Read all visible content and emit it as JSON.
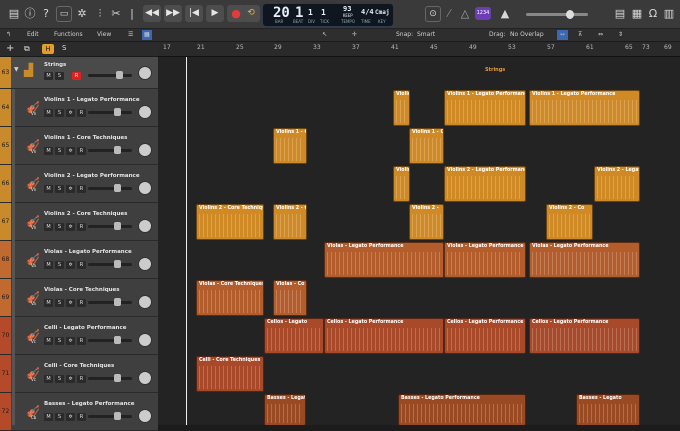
{
  "transport": {
    "bar": "20",
    "beat": "1",
    "div": "1",
    "tick": "1",
    "tempo": "93",
    "tempo_sub": "KEEP",
    "timesig": "4/4",
    "key": "Cmaj",
    "lbl_bar": "BAR",
    "lbl_beat": "BEAT",
    "lbl_div": "DIV",
    "lbl_tick": "TICK",
    "lbl_tempo": "TEMPO",
    "lbl_time": "TIME",
    "lbl_key": "KEY",
    "count_badge": "1234"
  },
  "editbar": {
    "edit": "Edit",
    "functions": "Functions",
    "view": "View",
    "snap_label": "Snap:",
    "snap_value": "Smart",
    "drag_label": "Drag:",
    "drag_value": "No Overlap"
  },
  "trackbar": {
    "hold": "H",
    "solo": "S"
  },
  "ruler": {
    "bars": [
      "17",
      "21",
      "25",
      "29",
      "33",
      "37",
      "41",
      "45",
      "49",
      "53",
      "57",
      "61",
      "65",
      "69",
      "73"
    ]
  },
  "colors": {
    "strings": "#c88a2a",
    "violins": "#d08a25",
    "violas": "#b45d2c",
    "celli": "#a84a2a",
    "basses": "#9a4a22"
  },
  "tracks": [
    {
      "num": "63",
      "name": "Strings",
      "icon": "folder",
      "rec": "R"
    },
    {
      "num": "64",
      "name": "Violins 1 - Legato Performance"
    },
    {
      "num": "65",
      "name": "Violins 1 - Core Techniques"
    },
    {
      "num": "66",
      "name": "Violins 2 - Legato Performance"
    },
    {
      "num": "67",
      "name": "Violins 2 - Core Techniques"
    },
    {
      "num": "68",
      "name": "Violas - Legato Performance"
    },
    {
      "num": "69",
      "name": "Violas - Core Techniques"
    },
    {
      "num": "70",
      "name": "Celli - Legato Performance"
    },
    {
      "num": "71",
      "name": "Celli - Core Techniques"
    },
    {
      "num": "72",
      "name": "Basses - Legato Performance"
    }
  ],
  "regions": {
    "strings": "Strings",
    "v1lp": [
      "Violins 1",
      "Violins 1 - Legato Performance",
      "Violins 1 - Legato Performance"
    ],
    "v1ct": [
      "Violins 1 - Co",
      "Violins 1 - Co"
    ],
    "v2lp": [
      "Violins 2",
      "Violins 2 - Legato Performance",
      "Violins 2 - Legato"
    ],
    "v2ct": [
      "Violins 2 - Core Techniques",
      "Violins 2 - C",
      "Violins 2 -",
      "Violins 2 - Co"
    ],
    "vlp": [
      "Violas - Legato Performance",
      "Violas - Legato Performance",
      "Violas - Legato Performance"
    ],
    "vct": [
      "Violas - Core Techniques",
      "Violas - Co"
    ],
    "clp": [
      "Cellos - Legato",
      "Cellos - Legato Performance",
      "Cellos - Legato Performance",
      "Cellos - Legato Performance"
    ],
    "cct": [
      "Celli - Core Techniques"
    ],
    "blp": [
      "Basses - Legato",
      "Basses - Legato Performance",
      "Basses - Legato"
    ]
  }
}
